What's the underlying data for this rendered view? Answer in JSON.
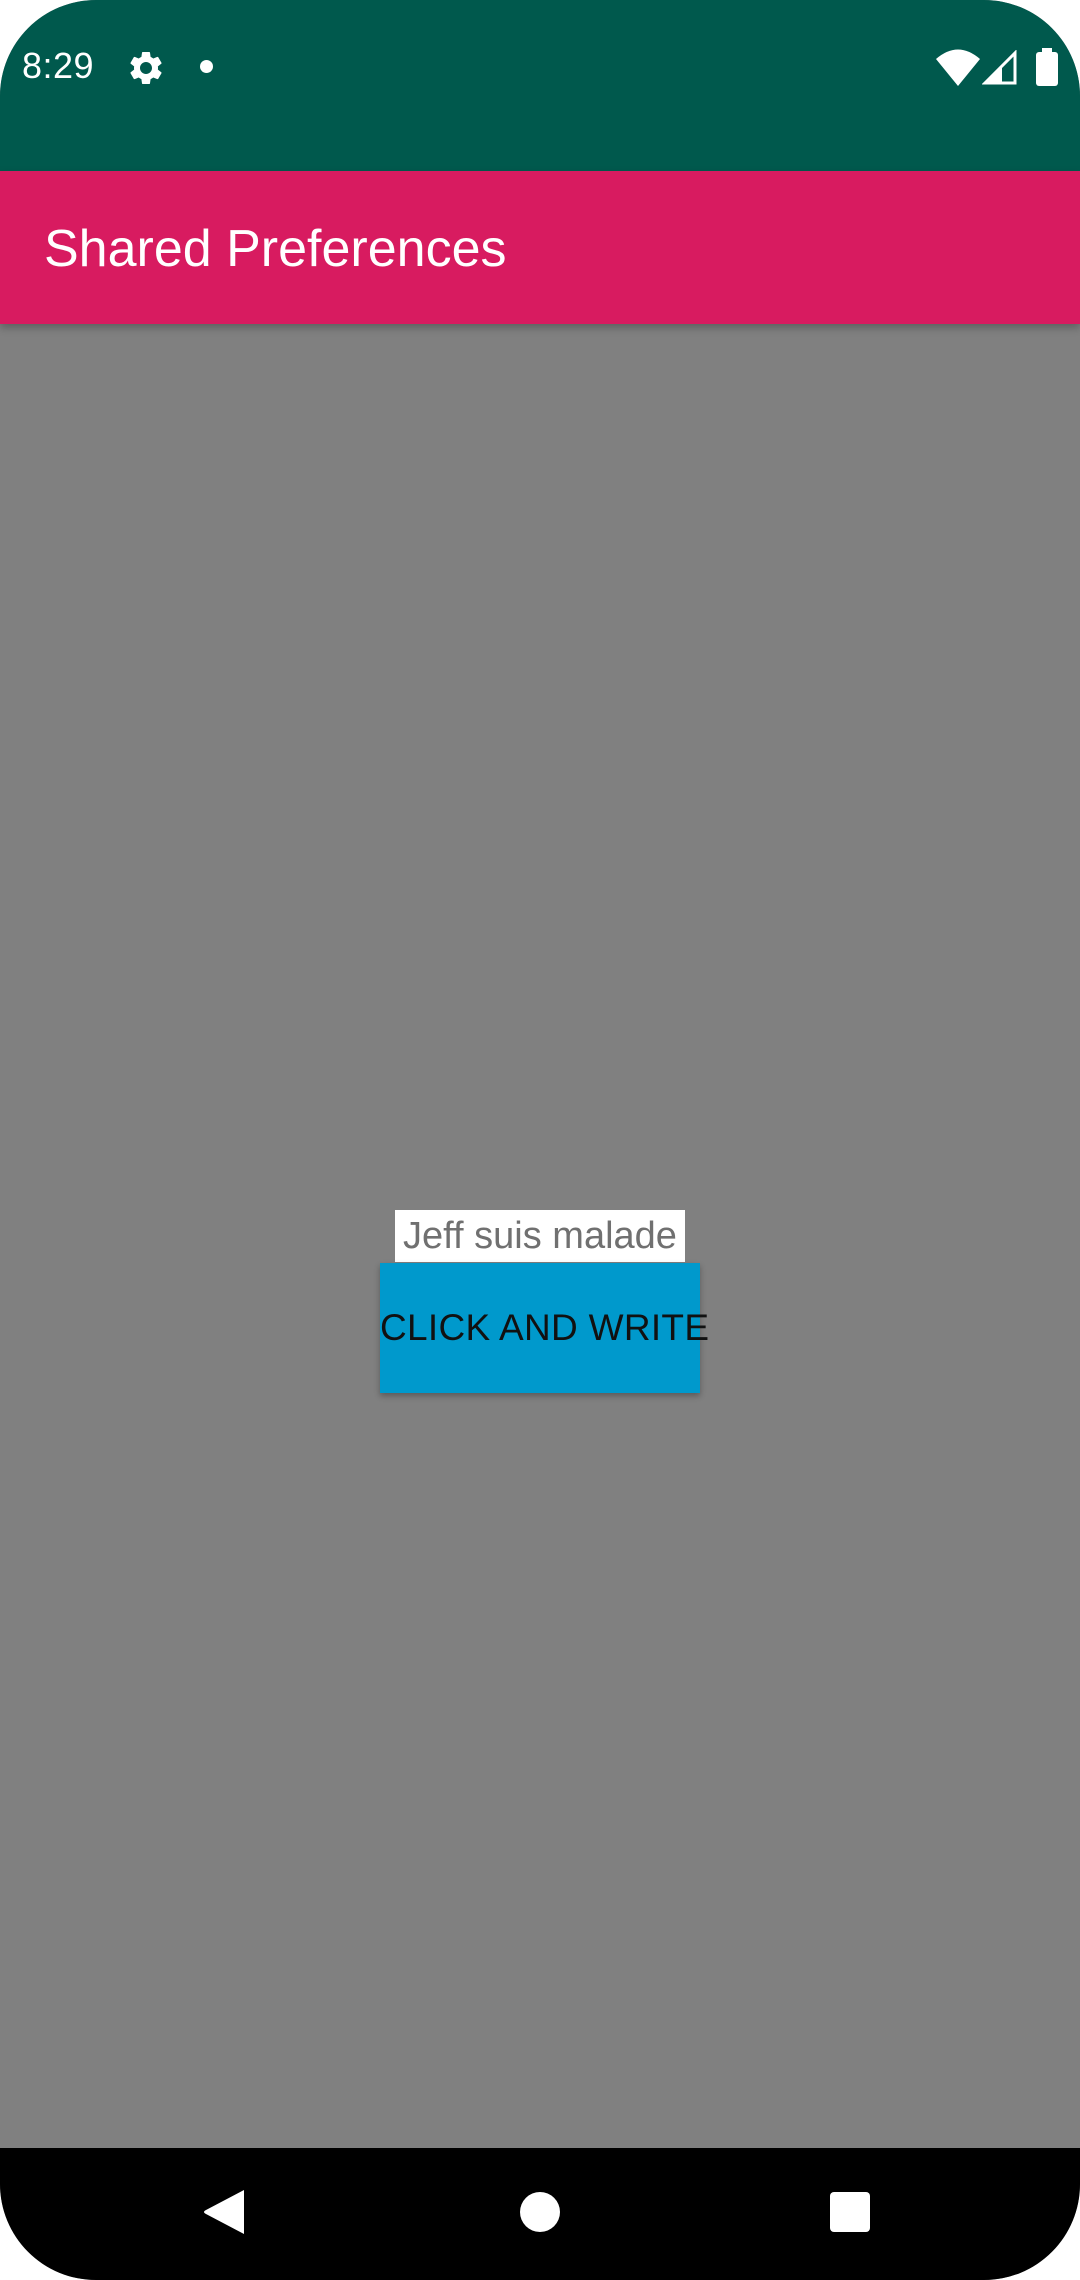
{
  "status_bar": {
    "time": "8:29",
    "icons": [
      "gear-icon",
      "notification-dot-icon",
      "wifi-icon",
      "signal-icon",
      "battery-icon"
    ],
    "background": "#00594d"
  },
  "app_bar": {
    "title": "Shared Preferences",
    "background": "#d81b60"
  },
  "content": {
    "background": "#808080",
    "saved_text": "Jeff suis malade",
    "button_label": "CLICK AND WRITE",
    "button_color": "#0099cc"
  },
  "nav_bar": {
    "icons": [
      "back-icon",
      "home-icon",
      "recents-icon"
    ]
  }
}
